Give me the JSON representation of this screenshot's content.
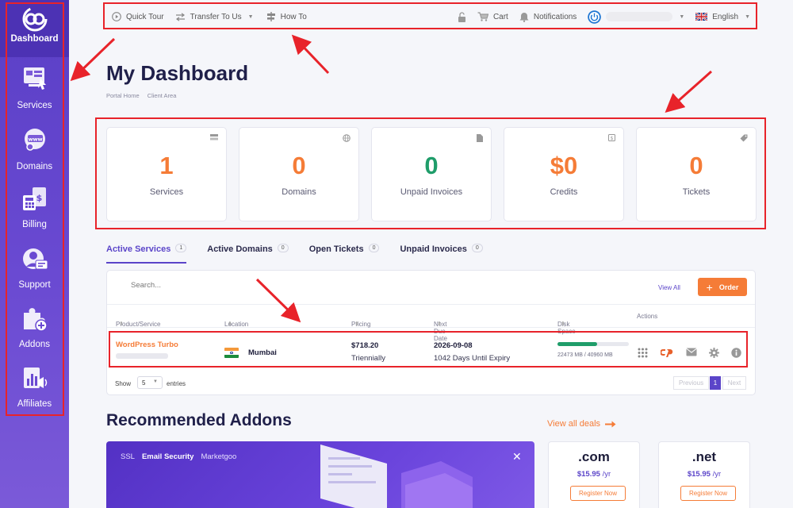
{
  "sidebar": {
    "items": [
      {
        "label": "Dashboard",
        "icon": "ccc-logo-icon"
      },
      {
        "label": "Services",
        "icon": "services-icon"
      },
      {
        "label": "Domains",
        "icon": "www-globe-icon"
      },
      {
        "label": "Billing",
        "icon": "billing-icon"
      },
      {
        "label": "Support",
        "icon": "support-icon"
      },
      {
        "label": "Addons",
        "icon": "puzzle-icon"
      },
      {
        "label": "Affiliates",
        "icon": "affiliates-icon"
      }
    ]
  },
  "topbar": {
    "quick_tour": "Quick Tour",
    "transfer": "Transfer To Us",
    "how_to": "How To",
    "cart": "Cart",
    "notifications": "Notifications",
    "language": "English"
  },
  "page": {
    "title": "My Dashboard",
    "breadcrumb": [
      "Portal Home",
      "Client Area"
    ]
  },
  "stats": [
    {
      "value": "1",
      "label": "Services",
      "color": "#f57c37",
      "icon": "server-icon"
    },
    {
      "value": "0",
      "label": "Domains",
      "color": "#f57c37",
      "icon": "globe-icon"
    },
    {
      "value": "0",
      "label": "Unpaid Invoices",
      "color": "#1f9d6a",
      "icon": "document-icon"
    },
    {
      "value": "$0",
      "label": "Credits",
      "color": "#f57c37",
      "icon": "wallet-icon"
    },
    {
      "value": "0",
      "label": "Tickets",
      "color": "#f57c37",
      "icon": "tag-icon"
    }
  ],
  "tabs": [
    {
      "label": "Active Services",
      "count": "1"
    },
    {
      "label": "Active Domains",
      "count": "0"
    },
    {
      "label": "Open Tickets",
      "count": "0"
    },
    {
      "label": "Unpaid Invoices",
      "count": "0"
    }
  ],
  "services_table": {
    "search_placeholder": "Search...",
    "view_all": "View All",
    "order": "Order",
    "columns": [
      "Product/Service",
      "Location",
      "Pricing",
      "Next Due Date",
      "Disk Space",
      "Actions"
    ],
    "row": {
      "product": "WordPress Turbo",
      "location": "Mumbai",
      "price": "$718.20",
      "cycle": "Triennially",
      "due_date": "2026-09-08",
      "days_until": "1042 Days Until Expiry",
      "disk_text": "22473 MB / 40960 MB",
      "disk_used_fraction": 0.55
    },
    "show_label": "Show",
    "entries_value": "5",
    "entries_label": "entries",
    "pagination": {
      "previous": "Previous",
      "current": "1",
      "next": "Next"
    }
  },
  "recommended": {
    "title": "Recommended Addons",
    "view_all_deals": "View all deals",
    "promo_tabs": [
      "SSL",
      "Email Security",
      "Marketgoo"
    ],
    "promo_active": "Email Security",
    "domains": [
      {
        "tld": ".com",
        "price": "$15.95",
        "per": "/yr",
        "button": "Register Now"
      },
      {
        "tld": ".net",
        "price": "$15.95",
        "per": "/yr",
        "button": "Register Now"
      }
    ]
  },
  "colors": {
    "sidebar": "#5a3fc6",
    "accent_orange": "#f57c37",
    "accent_purple": "#5b45c9",
    "success_green": "#1f9d6a",
    "annotation_red": "#e8232a"
  }
}
